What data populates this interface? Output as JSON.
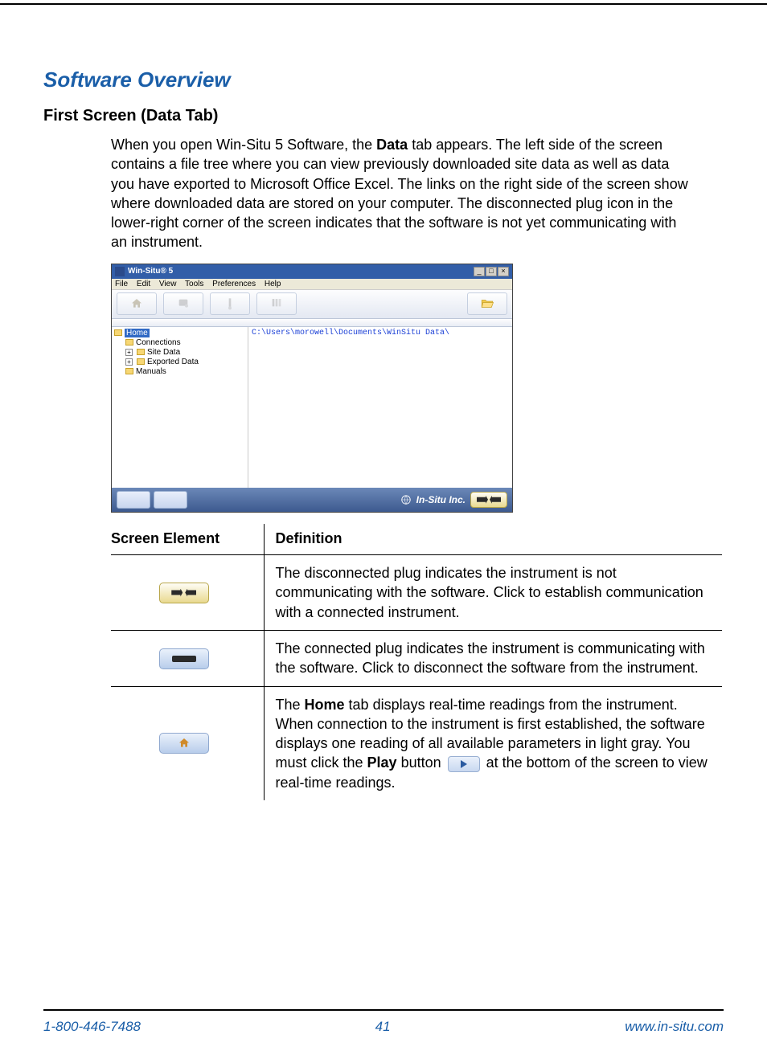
{
  "heading": "Software Overview",
  "subheading": "First Screen (Data Tab)",
  "intro": {
    "pre": "When you open Win-Situ 5 Software, the ",
    "bold": "Data",
    "post": " tab appears. The left side of the screen contains a file tree where you can view previously downloaded site data as well as data you have exported to Microsoft Office Excel. The links on the right side of the screen show where downloaded data are stored on your computer. The disconnected plug icon in the lower-right corner of the screen indicates that the software is not yet communicating with an instrument."
  },
  "screenshot": {
    "title": "Win-Situ® 5",
    "win_controls": {
      "min": "_",
      "max": "□",
      "close": "×"
    },
    "menus": [
      "File",
      "Edit",
      "View",
      "Tools",
      "Preferences",
      "Help"
    ],
    "tree": {
      "root": "Home",
      "items": [
        "Connections",
        "Site Data",
        "Exported Data",
        "Manuals"
      ]
    },
    "path": "C:\\Users\\morowell\\Documents\\WinSitu Data\\",
    "brand": "In-Situ Inc."
  },
  "table": {
    "headers": [
      "Screen Element",
      "Definition"
    ],
    "rows": [
      {
        "element_name": "disconnected-plug-icon",
        "text": "The disconnected plug indicates the instrument is not communicating with the software. Click to establish communication with a connected instrument."
      },
      {
        "element_name": "connected-plug-icon",
        "text": "The connected plug indicates the instrument is communicating with the software. Click to disconnect the software from the instrument."
      },
      {
        "element_name": "home-tab-icon",
        "pre": "The ",
        "b1": "Home",
        "mid": " tab displays real-time readings from the instrument. When connection to the instrument is first established, the software displays one reading of all available parameters in light gray. You must click the ",
        "b2": "Play",
        "mid2": " button ",
        "post": " at the bottom of the screen to view real-time readings."
      }
    ]
  },
  "footer": {
    "phone": "1-800-446-7488",
    "page": "41",
    "url": "www.in-situ.com"
  }
}
